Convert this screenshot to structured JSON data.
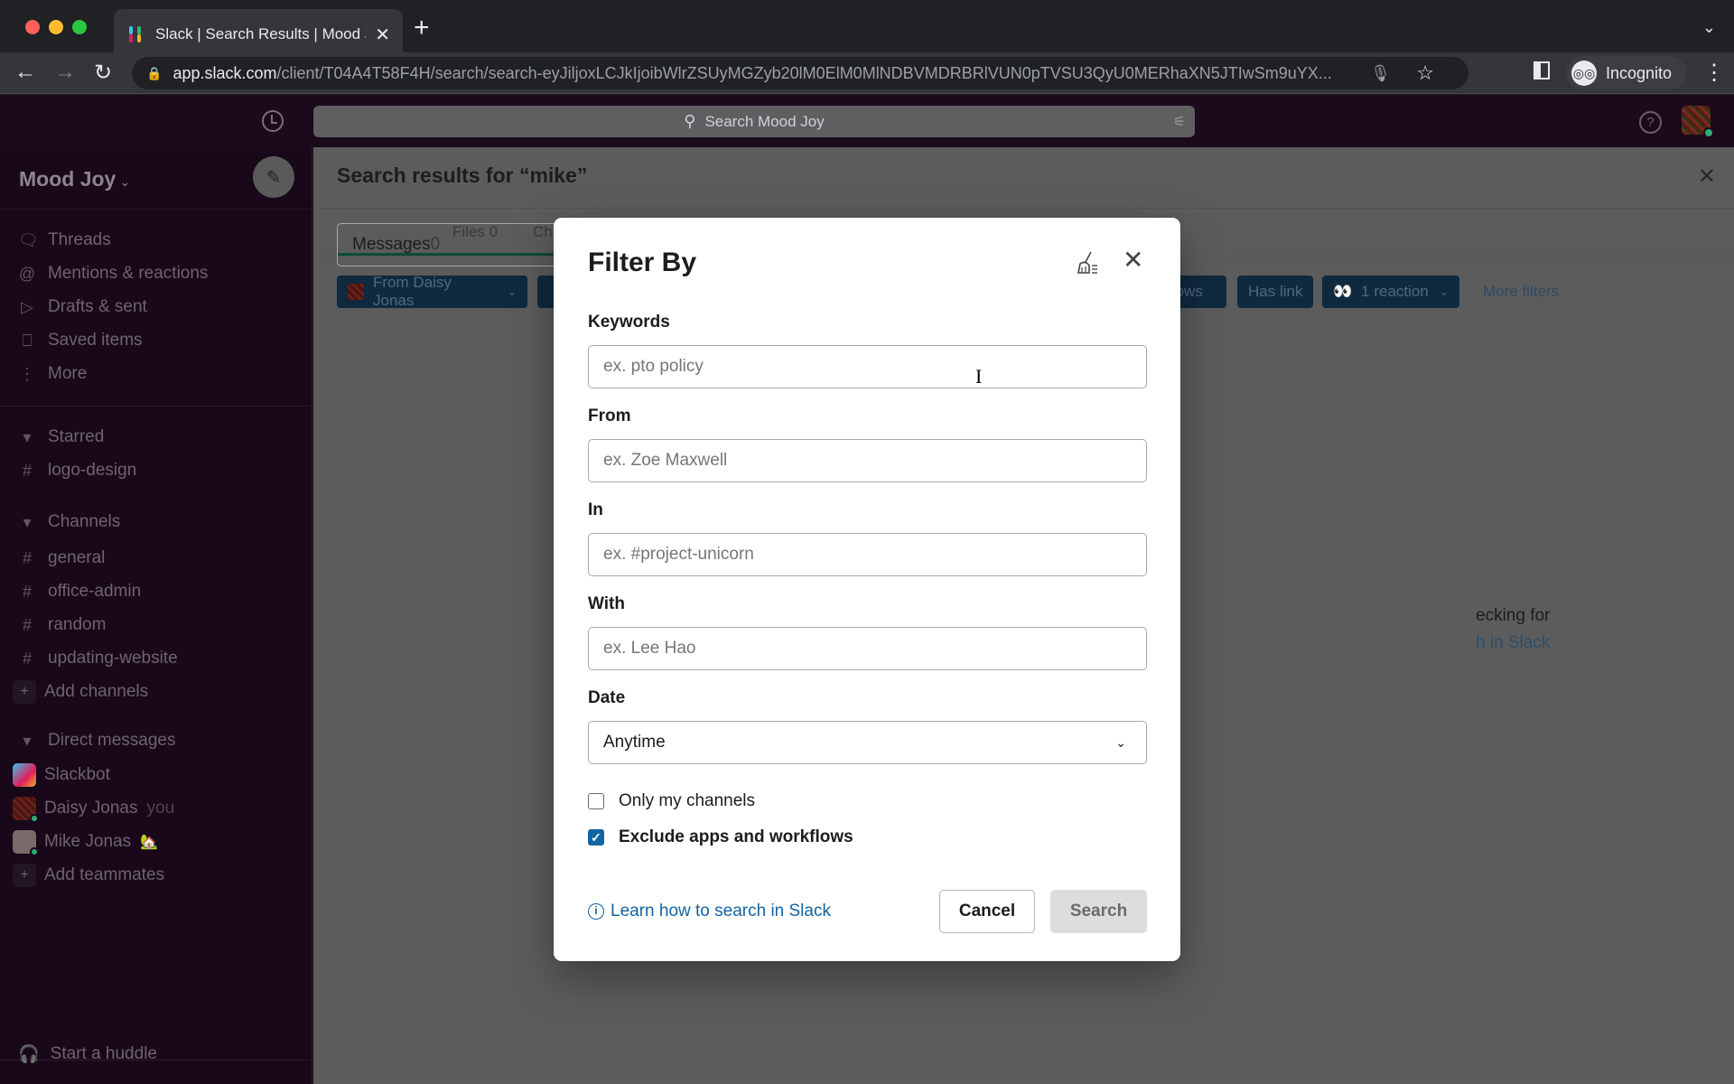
{
  "browser": {
    "tab_title": "Slack | Search Results | Mood Joy",
    "url_host": "app.slack.com",
    "url_path": "/client/T04A4T58F4H/search/search-eyJiljoxLCJkIjoibWlrZSUyMGZyb20lM0ElM0MlNDBVMDRBRlVUN0pTVSU3QyU0MERhaXN5JTIwSm9uYX...",
    "profile_label": "Incognito"
  },
  "topbar": {
    "search_placeholder": "Search Mood Joy"
  },
  "sidebar": {
    "workspace": "Mood Joy",
    "nav": [
      {
        "label": "Threads",
        "icon": "threads-icon"
      },
      {
        "label": "Mentions & reactions",
        "icon": "at-icon"
      },
      {
        "label": "Drafts & sent",
        "icon": "send-icon"
      },
      {
        "label": "Saved items",
        "icon": "bookmark-icon"
      },
      {
        "label": "More",
        "icon": "more-icon"
      }
    ],
    "starred_header": "Starred",
    "starred": [
      "logo-design"
    ],
    "channels_header": "Channels",
    "channels": [
      "general",
      "office-admin",
      "random",
      "updating-website"
    ],
    "add_channels": "Add channels",
    "dm_header": "Direct messages",
    "dms": [
      {
        "name": "Slackbot",
        "suffix": ""
      },
      {
        "name": "Daisy Jonas",
        "suffix": "you"
      },
      {
        "name": "Mike Jonas",
        "suffix": "🏡"
      }
    ],
    "add_teammates": "Add teammates",
    "huddle": "Start a huddle"
  },
  "main": {
    "title": "Search results for “mike”",
    "tabs": [
      {
        "label": "Messages",
        "count": "0"
      },
      {
        "label": "Files",
        "count": "0"
      },
      {
        "label": "Ch",
        "count": ""
      }
    ],
    "chips": {
      "from": "From Daisy Jonas",
      "workflows": "flows",
      "has_link": "Has link",
      "reaction": "1 reaction",
      "more": "More filters"
    },
    "empty_line1": "ecking for",
    "empty_line2": "h in Slack"
  },
  "modal": {
    "title": "Filter By",
    "keywords_label": "Keywords",
    "keywords_placeholder": "ex. pto policy",
    "keywords_value": "",
    "from_label": "From",
    "from_placeholder": "ex. Zoe Maxwell",
    "from_value": "",
    "in_label": "In",
    "in_placeholder": "ex. #project-unicorn",
    "in_value": "",
    "with_label": "With",
    "with_placeholder": "ex. Lee Hao",
    "with_value": "",
    "date_label": "Date",
    "date_value": "Anytime",
    "only_my_channels": "Only my channels",
    "only_my_channels_checked": false,
    "exclude_apps": "Exclude apps and workflows",
    "exclude_apps_checked": true,
    "learn_link": "Learn how to search in Slack",
    "cancel": "Cancel",
    "search": "Search"
  }
}
